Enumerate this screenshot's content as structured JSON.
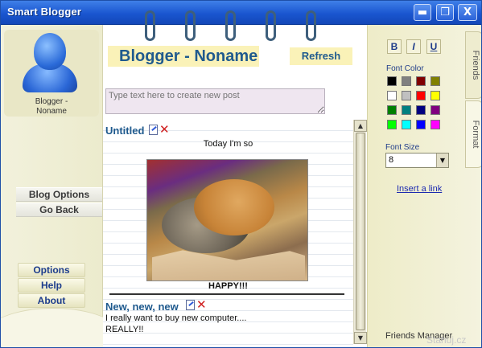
{
  "window": {
    "title": "Smart Blogger",
    "controls": {
      "minimize": "▬",
      "maximize": "❐",
      "close": "X"
    }
  },
  "profile": {
    "name_line1": "Blogger -",
    "name_line2": "Noname"
  },
  "left_nav": {
    "blog_options": "Blog Options",
    "go_back": "Go Back"
  },
  "bottom_menu": {
    "options": "Options",
    "help": "Help",
    "about": "About"
  },
  "header": {
    "title": "Blogger - Noname",
    "refresh_label": "Refresh"
  },
  "new_post": {
    "placeholder": "Type text here to create new post"
  },
  "posts": [
    {
      "title": "Untitled",
      "text": "Today I'm so",
      "caption": "HAPPY!!!"
    },
    {
      "title": "New, new, new",
      "lines": [
        "I really want to buy new computer....",
        "REALLY!!"
      ]
    }
  ],
  "format_panel": {
    "bold": "B",
    "italic": "I",
    "underline": "U",
    "font_color_label": "Font Color",
    "colors": [
      "#000000",
      "#808080",
      "#800000",
      "#808000",
      "#ffffff",
      "#c0c0c0",
      "#ff0000",
      "#ffff00",
      "#008000",
      "#008080",
      "#000080",
      "#800080",
      "#00ff00",
      "#00ffff",
      "#0000ff",
      "#ff00ff"
    ],
    "font_size_label": "Font Size",
    "font_size_value": "8",
    "insert_link": "Insert a link"
  },
  "tabs": {
    "friends": "Friends",
    "format": "Format"
  },
  "footer": {
    "friends_manager": "Friends Manager",
    "watermark": "Stahuj.cz"
  }
}
